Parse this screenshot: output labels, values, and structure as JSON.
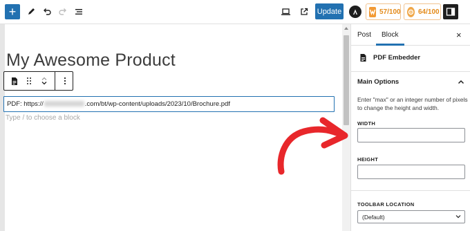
{
  "toolbar": {
    "add_icon": "+",
    "update_label": "Update",
    "seo_score": "57/100",
    "readability_score": "64/100"
  },
  "editor": {
    "post_title": "My Awesome Product",
    "pdf_prefix": "PDF: https://",
    "pdf_suffix": ".com/bt/wp-content/uploads/2023/10/Brochure.pdf",
    "choose_block_hint": "Type / to choose a block"
  },
  "sidebar": {
    "tabs": [
      {
        "label": "Post"
      },
      {
        "label": "Block"
      }
    ],
    "active_tab": "Block",
    "close_icon": "×",
    "block_name": "PDF Embedder",
    "panel_title": "Main Options",
    "help_text": "Enter \"max\" or an integer number of pixels to change the height and width.",
    "width_label": "WIDTH",
    "width_value": "",
    "height_label": "HEIGHT",
    "height_value": "",
    "toolbar_location_label": "TOOLBAR LOCATION",
    "toolbar_location_value": "(Default)"
  },
  "colors": {
    "accent": "#2271b1",
    "score": "#e38b1b",
    "arrow": "#e8272b"
  }
}
